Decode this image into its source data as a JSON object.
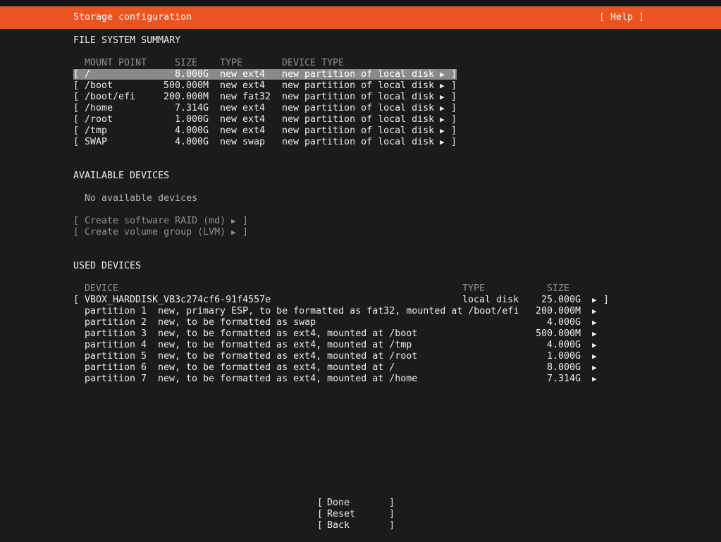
{
  "header": {
    "title": "Storage configuration",
    "help_label": "[ Help ]"
  },
  "fs_summary": {
    "heading": "FILE SYSTEM SUMMARY",
    "columns": {
      "mount": "MOUNT POINT",
      "size": "SIZE",
      "type": "TYPE",
      "device_type": "DEVICE TYPE"
    },
    "rows": [
      {
        "mount": "/",
        "size": "8.000G",
        "type": "new ext4",
        "device_type": "new partition of local disk"
      },
      {
        "mount": "/boot",
        "size": "500.000M",
        "type": "new ext4",
        "device_type": "new partition of local disk"
      },
      {
        "mount": "/boot/efi",
        "size": "200.000M",
        "type": "new fat32",
        "device_type": "new partition of local disk"
      },
      {
        "mount": "/home",
        "size": "7.314G",
        "type": "new ext4",
        "device_type": "new partition of local disk"
      },
      {
        "mount": "/root",
        "size": "1.000G",
        "type": "new ext4",
        "device_type": "new partition of local disk"
      },
      {
        "mount": "/tmp",
        "size": "4.000G",
        "type": "new ext4",
        "device_type": "new partition of local disk"
      },
      {
        "mount": "SWAP",
        "size": "4.000G",
        "type": "new swap",
        "device_type": "new partition of local disk"
      }
    ]
  },
  "available": {
    "heading": "AVAILABLE DEVICES",
    "empty_text": "No available devices",
    "actions": [
      {
        "label": "Create software RAID (md)"
      },
      {
        "label": "Create volume group (LVM)"
      }
    ]
  },
  "used": {
    "heading": "USED DEVICES",
    "columns": {
      "device": "DEVICE",
      "type": "TYPE",
      "size": "SIZE"
    },
    "disk": {
      "name": "VBOX_HARDDISK_VB3c274cf6-91f4557e",
      "type": "local disk",
      "size": "25.000G"
    },
    "partitions": [
      {
        "name": "partition 1",
        "desc": "new, primary ESP, to be formatted as fat32, mounted at /boot/efi",
        "size": "200.000M"
      },
      {
        "name": "partition 2",
        "desc": "new, to be formatted as swap",
        "size": "4.000G"
      },
      {
        "name": "partition 3",
        "desc": "new, to be formatted as ext4, mounted at /boot",
        "size": "500.000M"
      },
      {
        "name": "partition 4",
        "desc": "new, to be formatted as ext4, mounted at /tmp",
        "size": "4.000G"
      },
      {
        "name": "partition 5",
        "desc": "new, to be formatted as ext4, mounted at /root",
        "size": "1.000G"
      },
      {
        "name": "partition 6",
        "desc": "new, to be formatted as ext4, mounted at /",
        "size": "8.000G"
      },
      {
        "name": "partition 7",
        "desc": "new, to be formatted as ext4, mounted at /home",
        "size": "7.314G"
      }
    ]
  },
  "buttons": {
    "done": "Done",
    "reset": "Reset",
    "back": "Back"
  },
  "glyphs": {
    "arrow": "▶",
    "open_bracket": "[",
    "close_bracket": "]"
  },
  "colors": {
    "accent": "#e95420",
    "background": "#1b1b1b",
    "text": "#ececec",
    "selected_row": "#8a8a8a",
    "dim_text": "#8f8f8f"
  }
}
